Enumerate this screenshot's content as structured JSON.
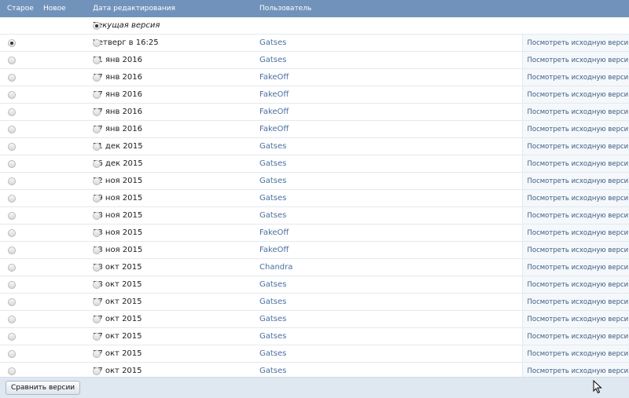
{
  "header": {
    "old": "Старое",
    "new": "Новое",
    "date": "Дата редактирования",
    "user": "Пользователь"
  },
  "current_row": {
    "label": "Текущая версия"
  },
  "rows": [
    {
      "date": "Четверг в 16:25",
      "user": "Gatses",
      "link": "Посмотреть исходную версию",
      "old_checked": true
    },
    {
      "date": "21 янв 2016",
      "user": "Gatses",
      "link": "Посмотреть исходную версию"
    },
    {
      "date": "17 янв 2016",
      "user": "FakeOff",
      "link": "Посмотреть исходную версию"
    },
    {
      "date": "17 янв 2016",
      "user": "FakeOff",
      "link": "Посмотреть исходную версию"
    },
    {
      "date": "17 янв 2016",
      "user": "FakeOff",
      "link": "Посмотреть исходную версию"
    },
    {
      "date": "17 янв 2016",
      "user": "FakeOff",
      "link": "Посмотреть исходную версию"
    },
    {
      "date": "21 дек 2015",
      "user": "Gatses",
      "link": "Посмотреть исходную версию"
    },
    {
      "date": "16 дек 2015",
      "user": "Gatses",
      "link": "Посмотреть исходную версию"
    },
    {
      "date": "22 ноя 2015",
      "user": "Gatses",
      "link": "Посмотреть исходную версию"
    },
    {
      "date": "19 ноя 2015",
      "user": "Gatses",
      "link": "Посмотреть исходную версию"
    },
    {
      "date": "18 ноя 2015",
      "user": "Gatses",
      "link": "Посмотреть исходную версию"
    },
    {
      "date": "13 ноя 2015",
      "user": "FakeOff",
      "link": "Посмотреть исходную версию"
    },
    {
      "date": "13 ноя 2015",
      "user": "FakeOff",
      "link": "Посмотреть исходную версию"
    },
    {
      "date": "28 окт 2015",
      "user": "Chandra",
      "link": "Посмотреть исходную версию"
    },
    {
      "date": "28 окт 2015",
      "user": "Gatses",
      "link": "Посмотреть исходную версию"
    },
    {
      "date": "27 окт 2015",
      "user": "Gatses",
      "link": "Посмотреть исходную версию"
    },
    {
      "date": "27 окт 2015",
      "user": "Gatses",
      "link": "Посмотреть исходную версию"
    },
    {
      "date": "27 окт 2015",
      "user": "Gatses",
      "link": "Посмотреть исходную версию"
    },
    {
      "date": "27 окт 2015",
      "user": "Gatses",
      "link": "Посмотреть исходную версию"
    },
    {
      "date": "27 окт 2015",
      "user": "Gatses",
      "link": "Посмотреть исходную версию"
    }
  ],
  "footer": {
    "compare_button": "Сравнить версии"
  },
  "colors": {
    "header_bg": "#7193bb",
    "link": "#3b5a82",
    "footer_bg": "#dfe8f1"
  }
}
